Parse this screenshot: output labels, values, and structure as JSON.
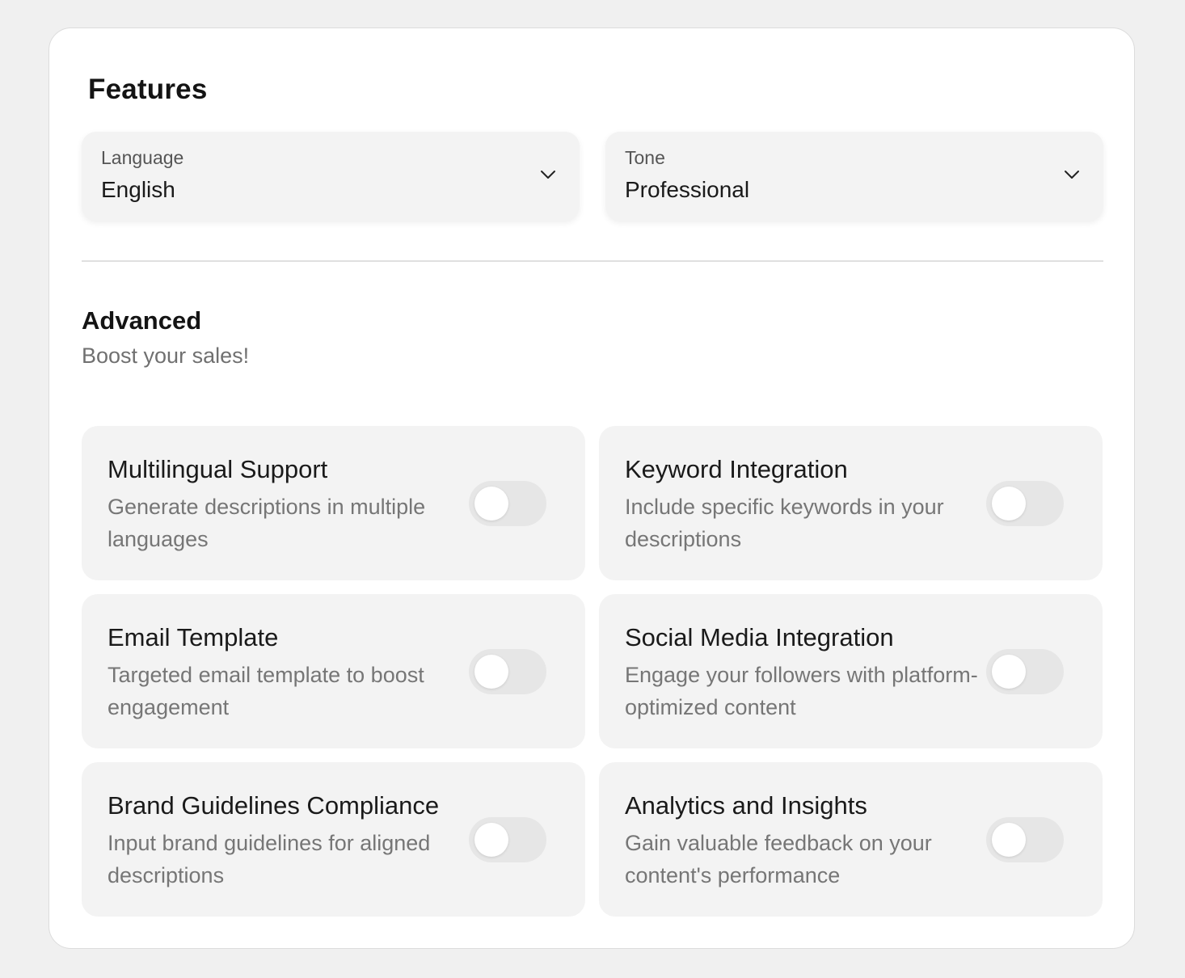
{
  "features": {
    "title": "Features",
    "language": {
      "label": "Language",
      "value": "English"
    },
    "tone": {
      "label": "Tone",
      "value": "Professional"
    }
  },
  "advanced": {
    "title": "Advanced",
    "subtitle": "Boost your sales!",
    "items": [
      {
        "title": "Multilingual Support",
        "description": "Generate descriptions in multiple languages",
        "enabled": false
      },
      {
        "title": "Keyword Integration",
        "description": "Include specific keywords in your descriptions",
        "enabled": false
      },
      {
        "title": "Email Template",
        "description": "Targeted email template to boost engagement",
        "enabled": false
      },
      {
        "title": "Social Media Integration",
        "description": "Engage your followers with platform-optimized content",
        "enabled": false
      },
      {
        "title": "Brand Guidelines Compliance",
        "description": "Input brand guidelines for aligned descriptions",
        "enabled": false
      },
      {
        "title": "Analytics and Insights",
        "description": "Gain valuable feedback on your content's performance",
        "enabled": false
      }
    ]
  },
  "icons": {
    "dropdown": "chevron-down-icon"
  },
  "colors": {
    "page_background": "#f0f0f0",
    "card_background": "#ffffff",
    "panel_background": "#f3f3f3",
    "toggle_off": "#e6e6e6",
    "toggle_knob": "#ffffff"
  }
}
